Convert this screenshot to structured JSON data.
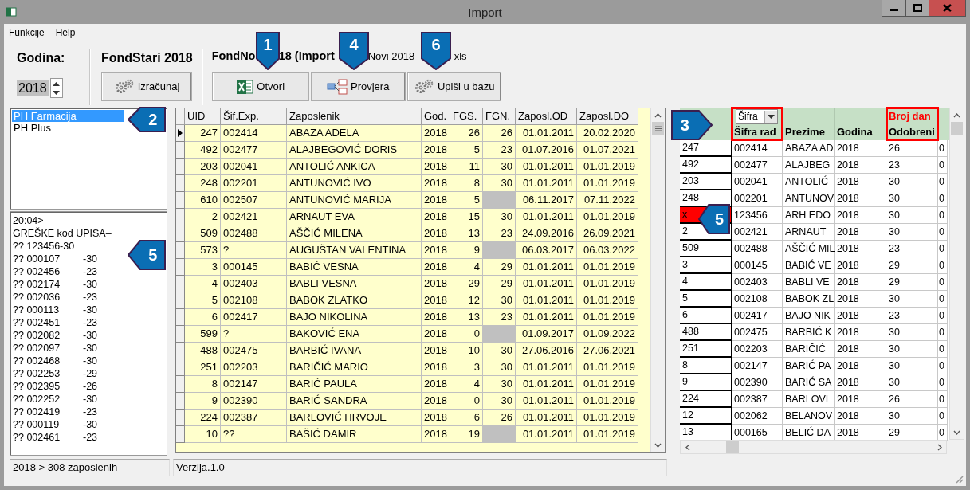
{
  "window": {
    "title": "Import"
  },
  "menu": [
    "Funkcije",
    "Help"
  ],
  "toolbar": {
    "year_label": "Godina:",
    "year": "2018",
    "old_fund": {
      "title": "FondStari 2018",
      "button": "Izračunaj"
    },
    "new_fund": {
      "title_parts": [
        "FondNo",
        "18 (Import",
        "Novi 2018",
        "xls"
      ],
      "buttons": [
        {
          "label": "Otvori",
          "kind": "excel"
        },
        {
          "label": "Provjera",
          "kind": "compare"
        },
        {
          "label": "Upiši u bazu",
          "kind": "gears"
        }
      ]
    }
  },
  "pharmacies": [
    {
      "label": "PH Farmacija",
      "selected": true
    },
    {
      "label": "PH Plus",
      "selected": false
    }
  ],
  "log": {
    "lines": [
      "20:04>",
      "GREŠKE kod UPISA–",
      "?? 123456-30"
    ],
    "entries": [
      {
        "code": "?? 000107",
        "value": "-30"
      },
      {
        "code": "?? 002456",
        "value": "-23"
      },
      {
        "code": "?? 002174",
        "value": "-30"
      },
      {
        "code": "?? 002036",
        "value": "-23"
      },
      {
        "code": "?? 000113",
        "value": "-30"
      },
      {
        "code": "?? 002451",
        "value": "-23"
      },
      {
        "code": "?? 002082",
        "value": "-30"
      },
      {
        "code": "?? 002097",
        "value": "-30"
      },
      {
        "code": "?? 002468",
        "value": "-30"
      },
      {
        "code": "?? 002253",
        "value": "-29"
      },
      {
        "code": "?? 002395",
        "value": "-26"
      },
      {
        "code": "?? 002252",
        "value": "-30"
      },
      {
        "code": "?? 002419",
        "value": "-23"
      },
      {
        "code": "?? 000119",
        "value": "-30"
      },
      {
        "code": "?? 002461",
        "value": "-23"
      }
    ]
  },
  "employees": {
    "columns": [
      "UID",
      "Šif.Exp.",
      "Zaposlenik",
      "God.",
      "FGS.",
      "FGN.",
      "Zaposl.OD",
      "Zaposl.DO"
    ],
    "rows": [
      {
        "current": true,
        "uid": "247",
        "code": "002414",
        "name": "ABAZA ADELA",
        "year": "2018",
        "fgs": "26",
        "fgn": "26",
        "from": "01.01.2011",
        "to": "20.02.2020"
      },
      {
        "current": false,
        "uid": "492",
        "code": "002477",
        "name": "ALAJBEGOVIĆ DORIS",
        "year": "2018",
        "fgs": "5",
        "fgn": "23",
        "from": "01.07.2016",
        "to": "01.07.2021"
      },
      {
        "current": false,
        "uid": "203",
        "code": "002041",
        "name": "ANTOLIĆ ANKICA",
        "year": "2018",
        "fgs": "11",
        "fgn": "30",
        "from": "01.01.2011",
        "to": "01.01.2019"
      },
      {
        "current": false,
        "uid": "248",
        "code": "002201",
        "name": "ANTUNOVIĆ IVO",
        "year": "2018",
        "fgs": "8",
        "fgn": "30",
        "from": "01.01.2011",
        "to": "01.01.2019"
      },
      {
        "current": false,
        "uid": "610",
        "code": "002507",
        "name": "ANTUNOVIĆ MARIJA",
        "year": "2018",
        "fgs": "5",
        "from": "06.11.2017",
        "to": "07.11.2022"
      },
      {
        "current": false,
        "uid": "2",
        "code": "002421",
        "name": "ARNAUT EVA",
        "year": "2018",
        "fgs": "15",
        "fgn": "30",
        "from": "01.01.2011",
        "to": "01.01.2019"
      },
      {
        "current": false,
        "uid": "509",
        "code": "002488",
        "name": "AŠČIĆ MILENA",
        "year": "2018",
        "fgs": "13",
        "fgn": "23",
        "from": "24.09.2016",
        "to": "26.09.2021"
      },
      {
        "current": false,
        "uid": "573",
        "code": "?",
        "name": "AUGUŠTAN VALENTINA",
        "year": "2018",
        "fgs": "9",
        "from": "06.03.2017",
        "to": "06.03.2022"
      },
      {
        "current": false,
        "uid": "3",
        "code": "000145",
        "name": "BABIĆ VESNA",
        "year": "2018",
        "fgs": "4",
        "fgn": "29",
        "from": "01.01.2011",
        "to": "01.01.2019"
      },
      {
        "current": false,
        "uid": "4",
        "code": "002403",
        "name": "BABLI VESNA",
        "year": "2018",
        "fgs": "29",
        "fgn": "29",
        "from": "01.01.2011",
        "to": "01.01.2019"
      },
      {
        "current": false,
        "uid": "5",
        "code": "002108",
        "name": "BABOK ZLATKO",
        "year": "2018",
        "fgs": "12",
        "fgn": "30",
        "from": "01.01.2011",
        "to": "01.01.2019"
      },
      {
        "current": false,
        "uid": "6",
        "code": "002417",
        "name": "BAJO NIKOLINA",
        "year": "2018",
        "fgs": "13",
        "fgn": "23",
        "from": "01.01.2011",
        "to": "01.01.2019"
      },
      {
        "current": false,
        "uid": "599",
        "code": "?",
        "name": "BAKOVIĆ ENA",
        "year": "2018",
        "fgs": "0",
        "from": "01.09.2017",
        "to": "01.09.2022"
      },
      {
        "current": false,
        "uid": "488",
        "code": "002475",
        "name": "BARBIĆ IVANA",
        "year": "2018",
        "fgs": "10",
        "fgn": "30",
        "from": "27.06.2016",
        "to": "27.06.2021"
      },
      {
        "current": false,
        "uid": "251",
        "code": "002203",
        "name": "BARIČIĆ MARIO",
        "year": "2018",
        "fgs": "3",
        "fgn": "30",
        "from": "01.01.2011",
        "to": "01.01.2019"
      },
      {
        "current": false,
        "uid": "8",
        "code": "002147",
        "name": "BARIĆ PAULA",
        "year": "2018",
        "fgs": "4",
        "fgn": "30",
        "from": "01.01.2011",
        "to": "01.01.2019"
      },
      {
        "current": false,
        "uid": "9",
        "code": "002390",
        "name": "BARIĆ SANDRA",
        "year": "2018",
        "fgs": "0",
        "fgn": "30",
        "from": "01.01.2011",
        "to": "01.01.2019"
      },
      {
        "current": false,
        "uid": "224",
        "code": "002387",
        "name": "BARLOVIĆ HRVOJE",
        "year": "2018",
        "fgs": "6",
        "fgn": "26",
        "from": "01.01.2011",
        "to": "01.01.2019"
      },
      {
        "current": false,
        "uid": "10",
        "code": "??",
        "name": "BAŠIĆ DAMIR",
        "year": "2018",
        "fgs": "19",
        "from": "01.01.2011",
        "to": "01.01.2019"
      }
    ]
  },
  "import_grid": {
    "columns": [
      {
        "label": "Šifra rad",
        "filter": "Šifra",
        "highlighted": true
      },
      {
        "label": "Prezime",
        "highlighted": false
      },
      {
        "label": "Godina",
        "highlighted": false
      },
      {
        "label": "Odobreni",
        "top": "Broj dan",
        "highlighted": true
      }
    ],
    "rows": [
      {
        "uid": "247",
        "error": false,
        "code": "002414",
        "name": "ABAZA AD",
        "year": "2018",
        "days": "26",
        "column_6": "0"
      },
      {
        "uid": "492",
        "error": false,
        "code": "002477",
        "name": "ALAJBEG",
        "year": "2018",
        "days": "23",
        "column_6": "0"
      },
      {
        "uid": "203",
        "error": false,
        "code": "002041",
        "name": "ANTOLIĆ",
        "year": "2018",
        "days": "30",
        "column_6": "0"
      },
      {
        "uid": "248",
        "error": false,
        "code": "002201",
        "name": "ANTUNOV",
        "year": "2018",
        "days": "30",
        "column_6": "0"
      },
      {
        "uid": "x",
        "error": true,
        "code": "123456",
        "name": "ARH EDO",
        "year": "2018",
        "days": "30",
        "column_6": "0"
      },
      {
        "uid": "2",
        "error": false,
        "code": "002421",
        "name": "ARNAUT",
        "year": "2018",
        "days": "30",
        "column_6": "0"
      },
      {
        "uid": "509",
        "error": false,
        "code": "002488",
        "name": "AŠČIĆ MIL",
        "year": "2018",
        "days": "23",
        "column_6": "0"
      },
      {
        "uid": "3",
        "error": false,
        "code": "000145",
        "name": "BABIĆ VE",
        "year": "2018",
        "days": "29",
        "column_6": "0"
      },
      {
        "uid": "4",
        "error": false,
        "code": "002403",
        "name": "BABLI VE",
        "year": "2018",
        "days": "29",
        "column_6": "0"
      },
      {
        "uid": "5",
        "error": false,
        "code": "002108",
        "name": "BABOK ZL",
        "year": "2018",
        "days": "30",
        "column_6": "0"
      },
      {
        "uid": "6",
        "error": false,
        "code": "002417",
        "name": "BAJO NIK",
        "year": "2018",
        "days": "23",
        "column_6": "0"
      },
      {
        "uid": "488",
        "error": false,
        "code": "002475",
        "name": "BARBIĆ K",
        "year": "2018",
        "days": "30",
        "column_6": "0"
      },
      {
        "uid": "251",
        "error": false,
        "code": "002203",
        "name": "BARIČIĆ",
        "year": "2018",
        "days": "30",
        "column_6": "0"
      },
      {
        "uid": "8",
        "error": false,
        "code": "002147",
        "name": "BARIĆ PA",
        "year": "2018",
        "days": "30",
        "column_6": "0"
      },
      {
        "uid": "9",
        "error": false,
        "code": "002390",
        "name": "BARIĆ SA",
        "year": "2018",
        "days": "30",
        "column_6": "0"
      },
      {
        "uid": "224",
        "error": false,
        "code": "002387",
        "name": "BARLOVI",
        "year": "2018",
        "days": "26",
        "column_6": "0"
      },
      {
        "uid": "12",
        "error": false,
        "code": "002062",
        "name": "BELANOV",
        "year": "2018",
        "days": "30",
        "column_6": "0"
      },
      {
        "uid": "13",
        "error": false,
        "code": "000165",
        "name": "BELIĆ DA",
        "year": "2018",
        "days": "29",
        "column_6": "0"
      }
    ]
  },
  "status": [
    "2018 > 308 zaposlenih",
    "Verzija.1.0"
  ],
  "callouts": [
    {
      "number": "1",
      "kind": "down"
    },
    {
      "number": "4",
      "kind": "down"
    },
    {
      "number": "6",
      "kind": "down"
    },
    {
      "number": "2",
      "kind": "left"
    },
    {
      "number": "3",
      "kind": "right"
    },
    {
      "number": "5",
      "kind": "left"
    },
    {
      "number": "5",
      "kind": "left"
    }
  ]
}
